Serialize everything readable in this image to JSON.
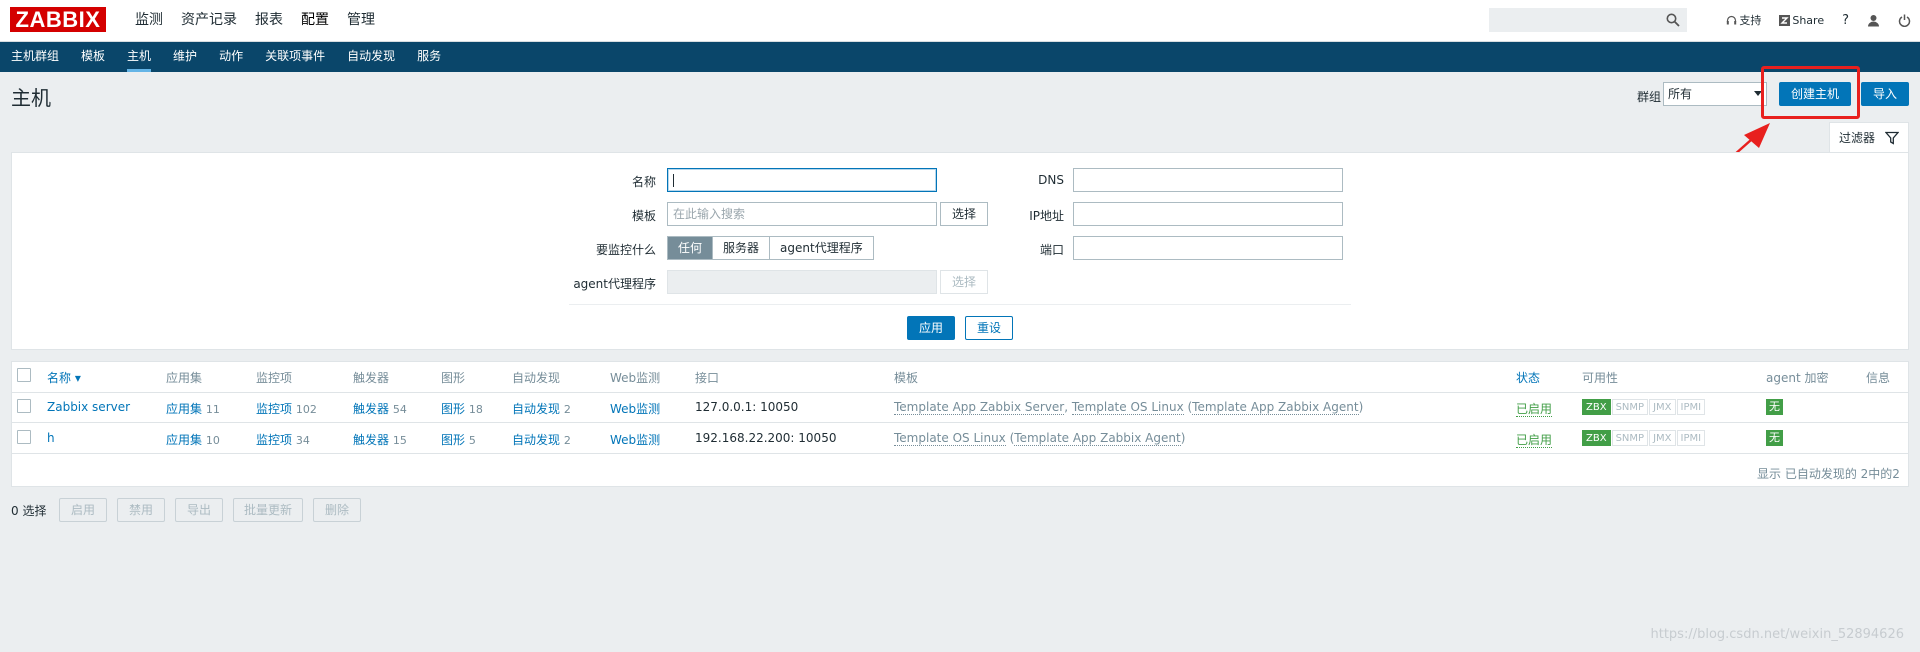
{
  "header": {
    "logo": "ZABBIX",
    "menu": [
      "监测",
      "资产记录",
      "报表",
      "配置",
      "管理"
    ],
    "active_menu": "配置",
    "links": {
      "support": "支持",
      "share": "Share",
      "help": "?"
    }
  },
  "subnav": {
    "items": [
      "主机群组",
      "模板",
      "主机",
      "维护",
      "动作",
      "关联项事件",
      "自动发现",
      "服务"
    ],
    "active": "主机"
  },
  "page": {
    "title": "主机",
    "group_label": "群组",
    "group_value": "所有",
    "create_button": "创建主机",
    "import_button": "导入",
    "filter_tab": "过滤器"
  },
  "filter": {
    "name_label": "名称",
    "name_value": "",
    "template_label": "模板",
    "template_placeholder": "在此输入搜索",
    "select_button": "选择",
    "monitored_by_label": "要监控什么",
    "monitored_by_options": [
      "任何",
      "服务器",
      "agent代理程序"
    ],
    "monitored_by_active": "任何",
    "proxy_label": "agent代理程序",
    "proxy_select_button": "选择",
    "dns_label": "DNS",
    "ip_label": "IP地址",
    "port_label": "端口",
    "apply_button": "应用",
    "reset_button": "重设"
  },
  "table": {
    "columns": [
      "名称 ▾",
      "应用集",
      "监控项",
      "触发器",
      "图形",
      "自动发现",
      "Web监测",
      "接口",
      "模板",
      "状态",
      "可用性",
      "agent 加密",
      "信息"
    ],
    "rows": [
      {
        "name": "Zabbix server",
        "applications": "应用集",
        "applications_count": "11",
        "items": "监控项",
        "items_count": "102",
        "triggers": "触发器",
        "triggers_count": "54",
        "graphs": "图形",
        "graphs_count": "18",
        "discovery": "自动发现",
        "discovery_count": "2",
        "web": "Web监测",
        "interface": "127.0.0.1: 10050",
        "templates": [
          "Template App Zabbix Server",
          "Template OS Linux",
          "Template App Zabbix Agent"
        ],
        "status": "已启用",
        "availability": [
          "ZBX",
          "SNMP",
          "JMX",
          "IPMI"
        ],
        "encryption": "无"
      },
      {
        "name": "h",
        "applications": "应用集",
        "applications_count": "10",
        "items": "监控项",
        "items_count": "34",
        "triggers": "触发器",
        "triggers_count": "15",
        "graphs": "图形",
        "graphs_count": "5",
        "discovery": "自动发现",
        "discovery_count": "2",
        "web": "Web监测",
        "interface": "192.168.22.200: 10050",
        "templates": [
          "Template OS Linux",
          "Template App Zabbix Agent"
        ],
        "status": "已启用",
        "availability": [
          "ZBX",
          "SNMP",
          "JMX",
          "IPMI"
        ],
        "encryption": "无"
      }
    ],
    "footer": "显示 已自动发现的 2中的2"
  },
  "bottom": {
    "selected": "0 选择",
    "actions": [
      "启用",
      "禁用",
      "导出",
      "批量更新",
      "删除"
    ]
  },
  "watermark": "https://blog.csdn.net/weixin_52894626",
  "colors": {
    "brand": "#d40000",
    "nav": "#0a466a",
    "accent": "#0275b8",
    "success": "#429e47",
    "highlight": "#e8201e"
  }
}
